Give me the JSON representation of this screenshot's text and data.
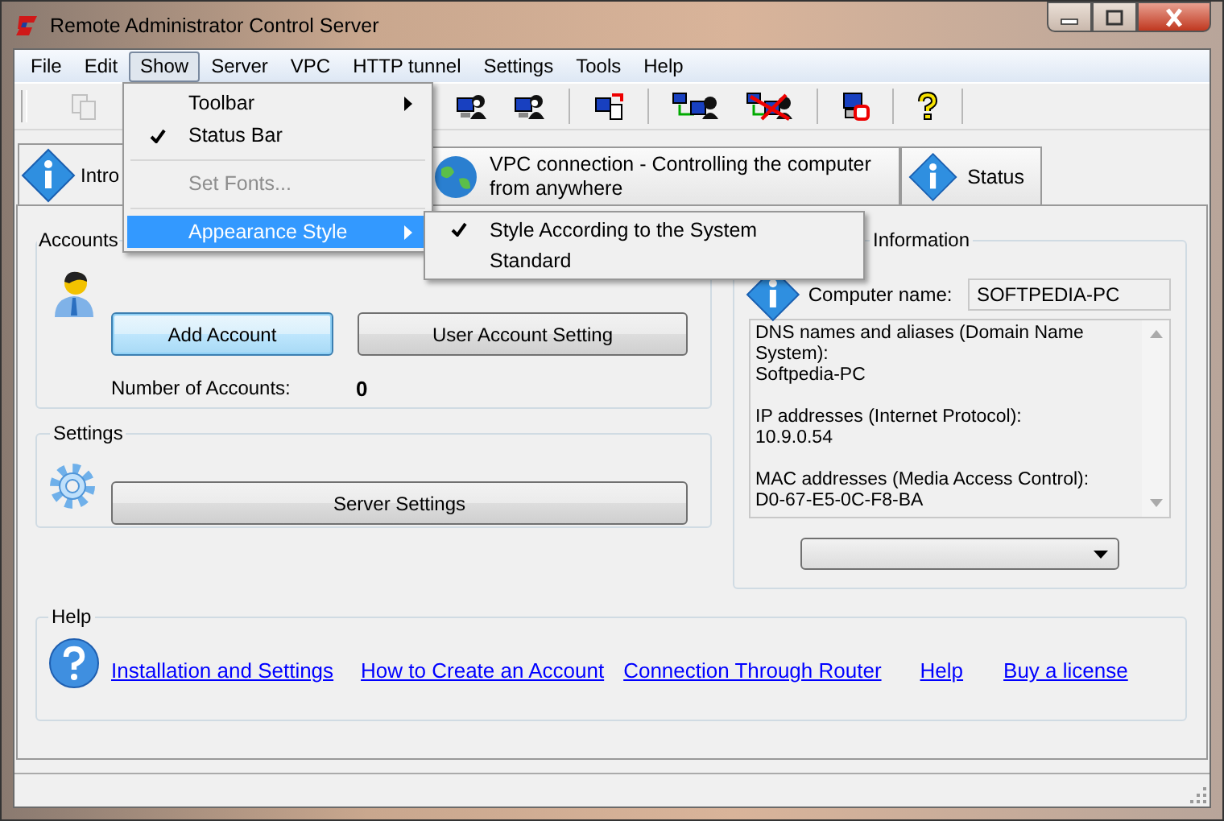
{
  "window": {
    "title": "Remote Administrator Control Server"
  },
  "menu_bar": [
    {
      "label": "File",
      "selected": false
    },
    {
      "label": "Edit",
      "selected": false
    },
    {
      "label": "Show",
      "selected": true
    },
    {
      "label": "Server",
      "selected": false
    },
    {
      "label": "VPC",
      "selected": false
    },
    {
      "label": "HTTP tunnel",
      "selected": false
    },
    {
      "label": "Settings",
      "selected": false
    },
    {
      "label": "Tools",
      "selected": false
    },
    {
      "label": "Help",
      "selected": false
    }
  ],
  "toolbar": [
    {
      "kind": "copy",
      "disabled": true
    },
    {
      "kind": "user",
      "disabled": false
    },
    {
      "kind": "user",
      "disabled": false
    },
    {
      "kind": "separator"
    },
    {
      "kind": "share",
      "disabled": false
    },
    {
      "kind": "separator"
    },
    {
      "kind": "connect",
      "disabled": false
    },
    {
      "kind": "disconnect",
      "disabled": false
    },
    {
      "kind": "separator"
    },
    {
      "kind": "screen",
      "disabled": false
    },
    {
      "kind": "separator"
    },
    {
      "kind": "help",
      "disabled": false
    },
    {
      "kind": "separator"
    }
  ],
  "tabs": [
    {
      "label": "Intro",
      "selected": true,
      "kind": "info"
    },
    {
      "label": "VPC connection - Controlling the computer from anywhere",
      "selected": false,
      "kind": "globe"
    },
    {
      "label": "Status",
      "selected": false,
      "kind": "info"
    }
  ],
  "show_menu": [
    {
      "kind": "item",
      "label": "Toolbar",
      "submenu": true,
      "checked": false,
      "disabled": false,
      "selected": false
    },
    {
      "kind": "item",
      "label": "Status Bar",
      "submenu": false,
      "checked": true,
      "disabled": false,
      "selected": false
    },
    {
      "kind": "separator"
    },
    {
      "kind": "item",
      "label": "Set Fonts...",
      "submenu": false,
      "checked": false,
      "disabled": true,
      "selected": false
    },
    {
      "kind": "separator"
    },
    {
      "kind": "item",
      "label": "Appearance Style",
      "submenu": true,
      "checked": false,
      "disabled": false,
      "selected": true
    }
  ],
  "appearance_submenu": [
    {
      "label": "Style According to the System",
      "checked": true
    },
    {
      "label": "Standard",
      "checked": false
    }
  ],
  "accounts": {
    "title": "Accounts",
    "buttons": [
      {
        "label": "Add Account",
        "focused": true
      },
      {
        "label": "User Account Setting",
        "focused": false
      }
    ],
    "count_label": "Number of Accounts:",
    "count": "0"
  },
  "settings": {
    "title": "Settings",
    "button": "Server Settings"
  },
  "information": {
    "title": "Information",
    "computer_name_label": "Computer name:",
    "computer_name": "SOFTPEDIA-PC",
    "details": [
      {
        "heading": "DNS names and aliases (Domain Name System):",
        "value": "Softpedia-PC"
      },
      {
        "heading": "IP addresses (Internet Protocol):",
        "value": "10.9.0.54"
      },
      {
        "heading": "MAC addresses (Media Access Control):",
        "value": "D0-67-E5-0C-F8-BA"
      }
    ]
  },
  "help": {
    "title": "Help",
    "links": [
      "Installation and Settings",
      "How to Create an Account",
      "Connection Through Router",
      "Help",
      "Buy a license"
    ]
  }
}
